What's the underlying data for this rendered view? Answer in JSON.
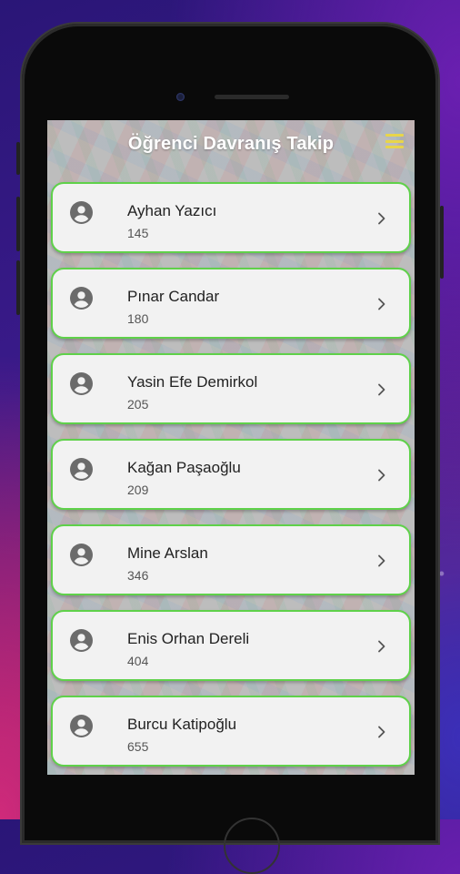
{
  "app": {
    "title": "Öğrenci Davranış Takip",
    "menu_icon": "hamburger-menu-icon",
    "accent_color": "#5fd14a",
    "menu_color": "#e8d54a"
  },
  "students": [
    {
      "name": "Ayhan Yazıcı",
      "number": "145"
    },
    {
      "name": "Pınar Candar",
      "number": "180"
    },
    {
      "name": "Yasin Efe Demirkol",
      "number": "205"
    },
    {
      "name": "Kağan Paşaoğlu",
      "number": "209"
    },
    {
      "name": "Mine Arslan",
      "number": "346"
    },
    {
      "name": "Enis Orhan Dereli",
      "number": "404"
    },
    {
      "name": "Burcu Katipoğlu",
      "number": "655"
    }
  ],
  "icons": {
    "avatar": "account-circle-icon",
    "chevron": "chevron-right-icon"
  }
}
